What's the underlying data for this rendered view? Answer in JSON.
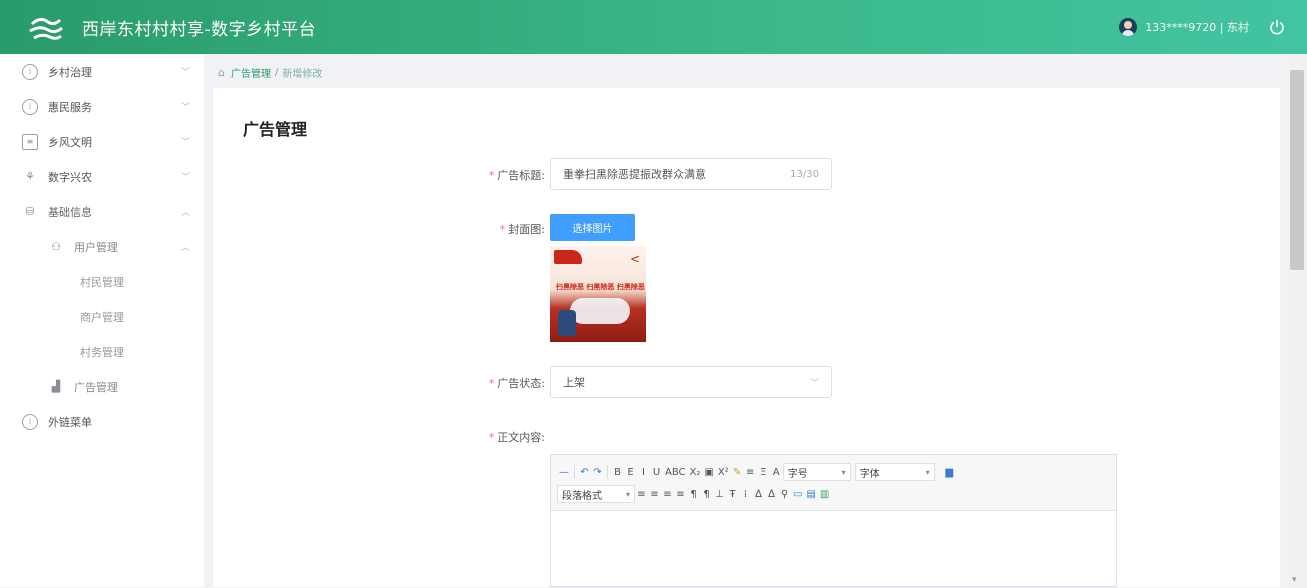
{
  "header": {
    "title": "西岸东村村村享-数字乡村平台",
    "user": "133****9720 | 东村",
    "colors": {
      "start": "#2a9b6a",
      "end": "#43c4a2"
    }
  },
  "sidebar": {
    "items": [
      {
        "label": "乡村治理",
        "icon": "circle-grid-icon"
      },
      {
        "label": "惠民服务",
        "icon": "circle-grid-icon"
      },
      {
        "label": "乡风文明",
        "icon": "document-icon"
      },
      {
        "label": "数字兴农",
        "icon": "sprout-icon"
      },
      {
        "label": "基础信息",
        "icon": "database-icon"
      }
    ],
    "sub_group": {
      "label": "用户管理",
      "icon": "users-icon"
    },
    "leaves": [
      "村民管理",
      "商户管理",
      "村务管理"
    ],
    "ad_item": {
      "label": "广告管理",
      "icon": "chart-icon"
    },
    "external": {
      "label": "外链菜单",
      "icon": "circle-grid-icon"
    }
  },
  "breadcrumb": {
    "root": "广告管理",
    "sep": "/",
    "current": "新增修改"
  },
  "page": {
    "title": "广告管理"
  },
  "form": {
    "title_label": "广告标题:",
    "title_value": "重拳扫黑除恶提振改群众满意",
    "title_counter": "13/30",
    "cover_label": "封面图:",
    "upload_label": "选择图片",
    "cover_slogan": "扫黑除恶 扫黑除恶 扫黑除恶",
    "status_label": "广告状态:",
    "status_value": "上架",
    "content_label": "正文内容:"
  },
  "editor": {
    "font_size_label": "字号",
    "font_family_label": "字体",
    "paragraph_label": "段落格式",
    "row1": [
      "—",
      "↶",
      "↷",
      "B",
      "E",
      "I",
      "U",
      "ABC",
      "X₂",
      "▣",
      "X²",
      "✎",
      "≡",
      "Ξ",
      "A"
    ],
    "row2": [
      "≡",
      "≡",
      "≡",
      "≡",
      "¶",
      "¶",
      "⊥",
      "Ŧ",
      "⁞",
      "ᐃ",
      "ᐃ",
      "⚲",
      "▭",
      "▤",
      "▥"
    ]
  }
}
